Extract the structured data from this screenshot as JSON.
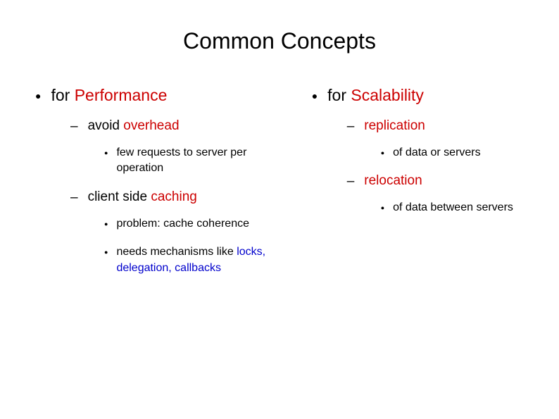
{
  "title": "Common Concepts",
  "left": {
    "heading_pre": "for ",
    "heading_em": "Performance",
    "item1_pre": "avoid ",
    "item1_em": "overhead",
    "item1_sub1": "few requests to server per operation",
    "item2_pre": "client side ",
    "item2_em": "caching",
    "item2_sub1": "problem: cache coherence",
    "item2_sub2_pre": "needs mechanisms like ",
    "item2_sub2_em": "locks, delegation, callbacks"
  },
  "right": {
    "heading_pre": "for ",
    "heading_em": "Scalability",
    "item1_em": "replication",
    "item1_sub1": "of data or servers",
    "item2_em": "relocation",
    "item2_sub1": "of data between servers"
  }
}
